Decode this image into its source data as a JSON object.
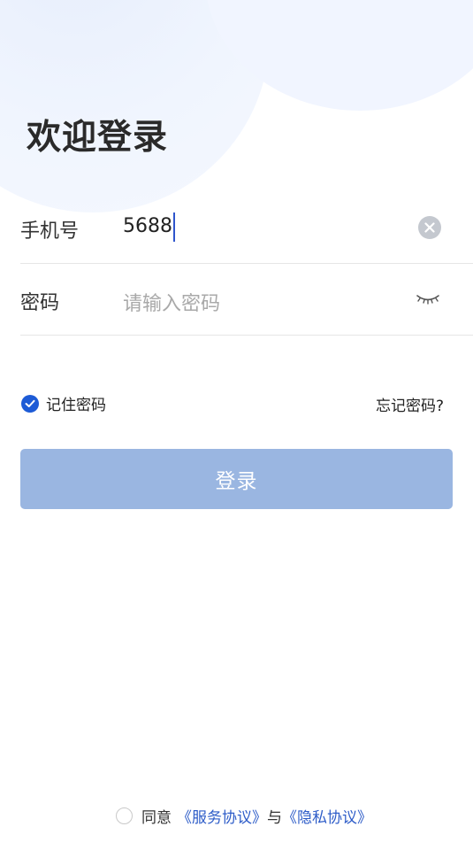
{
  "page": {
    "title": "欢迎登录"
  },
  "form": {
    "phone": {
      "label": "手机号",
      "value": "5688"
    },
    "password": {
      "label": "密码",
      "placeholder": "请输入密码"
    },
    "remember_label": "记住密码",
    "remember_checked": true,
    "forgot_label": "忘记密码?",
    "login_label": "登录"
  },
  "agreement": {
    "agree_text": "同意",
    "service_link": "《服务协议》",
    "and_text": "与",
    "privacy_link": "《隐私协议》",
    "checked": false
  },
  "icons": {
    "clear": "clear-icon",
    "eye": "eye-closed-icon",
    "check": "checkmark-icon"
  },
  "colors": {
    "accent": "#1d5bd6",
    "button_disabled": "#9ab6e1",
    "link": "#2d5cc8"
  }
}
